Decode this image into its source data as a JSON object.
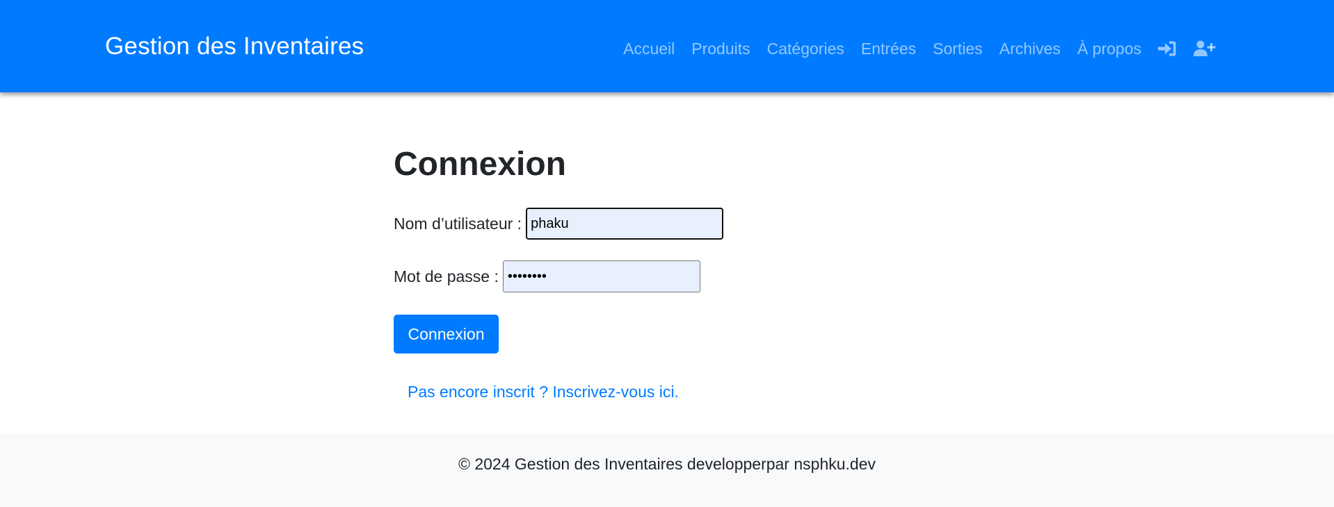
{
  "navbar": {
    "brand": "Gestion des Inventaires",
    "links": [
      {
        "label": "Accueil"
      },
      {
        "label": "Produits"
      },
      {
        "label": "Catégories"
      },
      {
        "label": "Entrées"
      },
      {
        "label": "Sorties"
      },
      {
        "label": "Archives"
      },
      {
        "label": "À propos"
      }
    ],
    "icons": [
      "sign-in-icon",
      "user-plus-icon"
    ]
  },
  "login": {
    "title": "Connexion",
    "username_label": "Nom d’utilisateur :",
    "username_value": "phaku",
    "password_label": "Mot de passe :",
    "password_value": "••••••••",
    "submit_label": "Connexion",
    "register_link": "Pas encore inscrit ? Inscrivez-vous ici."
  },
  "footer": {
    "text": "© 2024 Gestion des Inventaires developperpar nsphku.dev"
  },
  "colors": {
    "primary": "#007bff",
    "navbar_link": "rgba(255,255,255,0.58)",
    "autofill_bg": "#e8f0fe",
    "footer_bg": "#f8f9fa"
  }
}
